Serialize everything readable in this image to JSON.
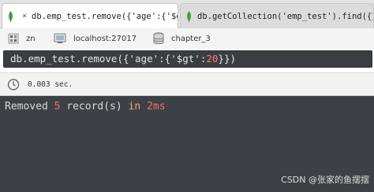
{
  "tabs": [
    {
      "label": "db.emp_test.remove({'age':{'$gt'⋯",
      "active": true,
      "close_label": "×"
    },
    {
      "label": "db.getCollection('emp_test').find({})",
      "active": false,
      "close_label": "×"
    }
  ],
  "connection": {
    "user": "zn",
    "server": "localhost:27017",
    "database": "chapter_3"
  },
  "query": {
    "prefix": "db.emp_test.remove({'age':{'$gt':",
    "number": "20",
    "suffix": "}})"
  },
  "status": {
    "elapsed": "0.003 sec."
  },
  "result": {
    "word1": "Removed",
    "count": "5",
    "word2": "record(s)",
    "word3": "in",
    "time": "2ms"
  },
  "watermark": "CSDN @张家的鱼摆摆",
  "colors": {
    "leaf": "#4caf50",
    "editor_bg": "#3a3e42",
    "results_bg": "#3d4145",
    "number": "#e57373"
  },
  "icons": [
    "mongodb-leaf-icon",
    "close-icon",
    "user-icon",
    "server-icon",
    "database-icon",
    "timer-icon"
  ]
}
